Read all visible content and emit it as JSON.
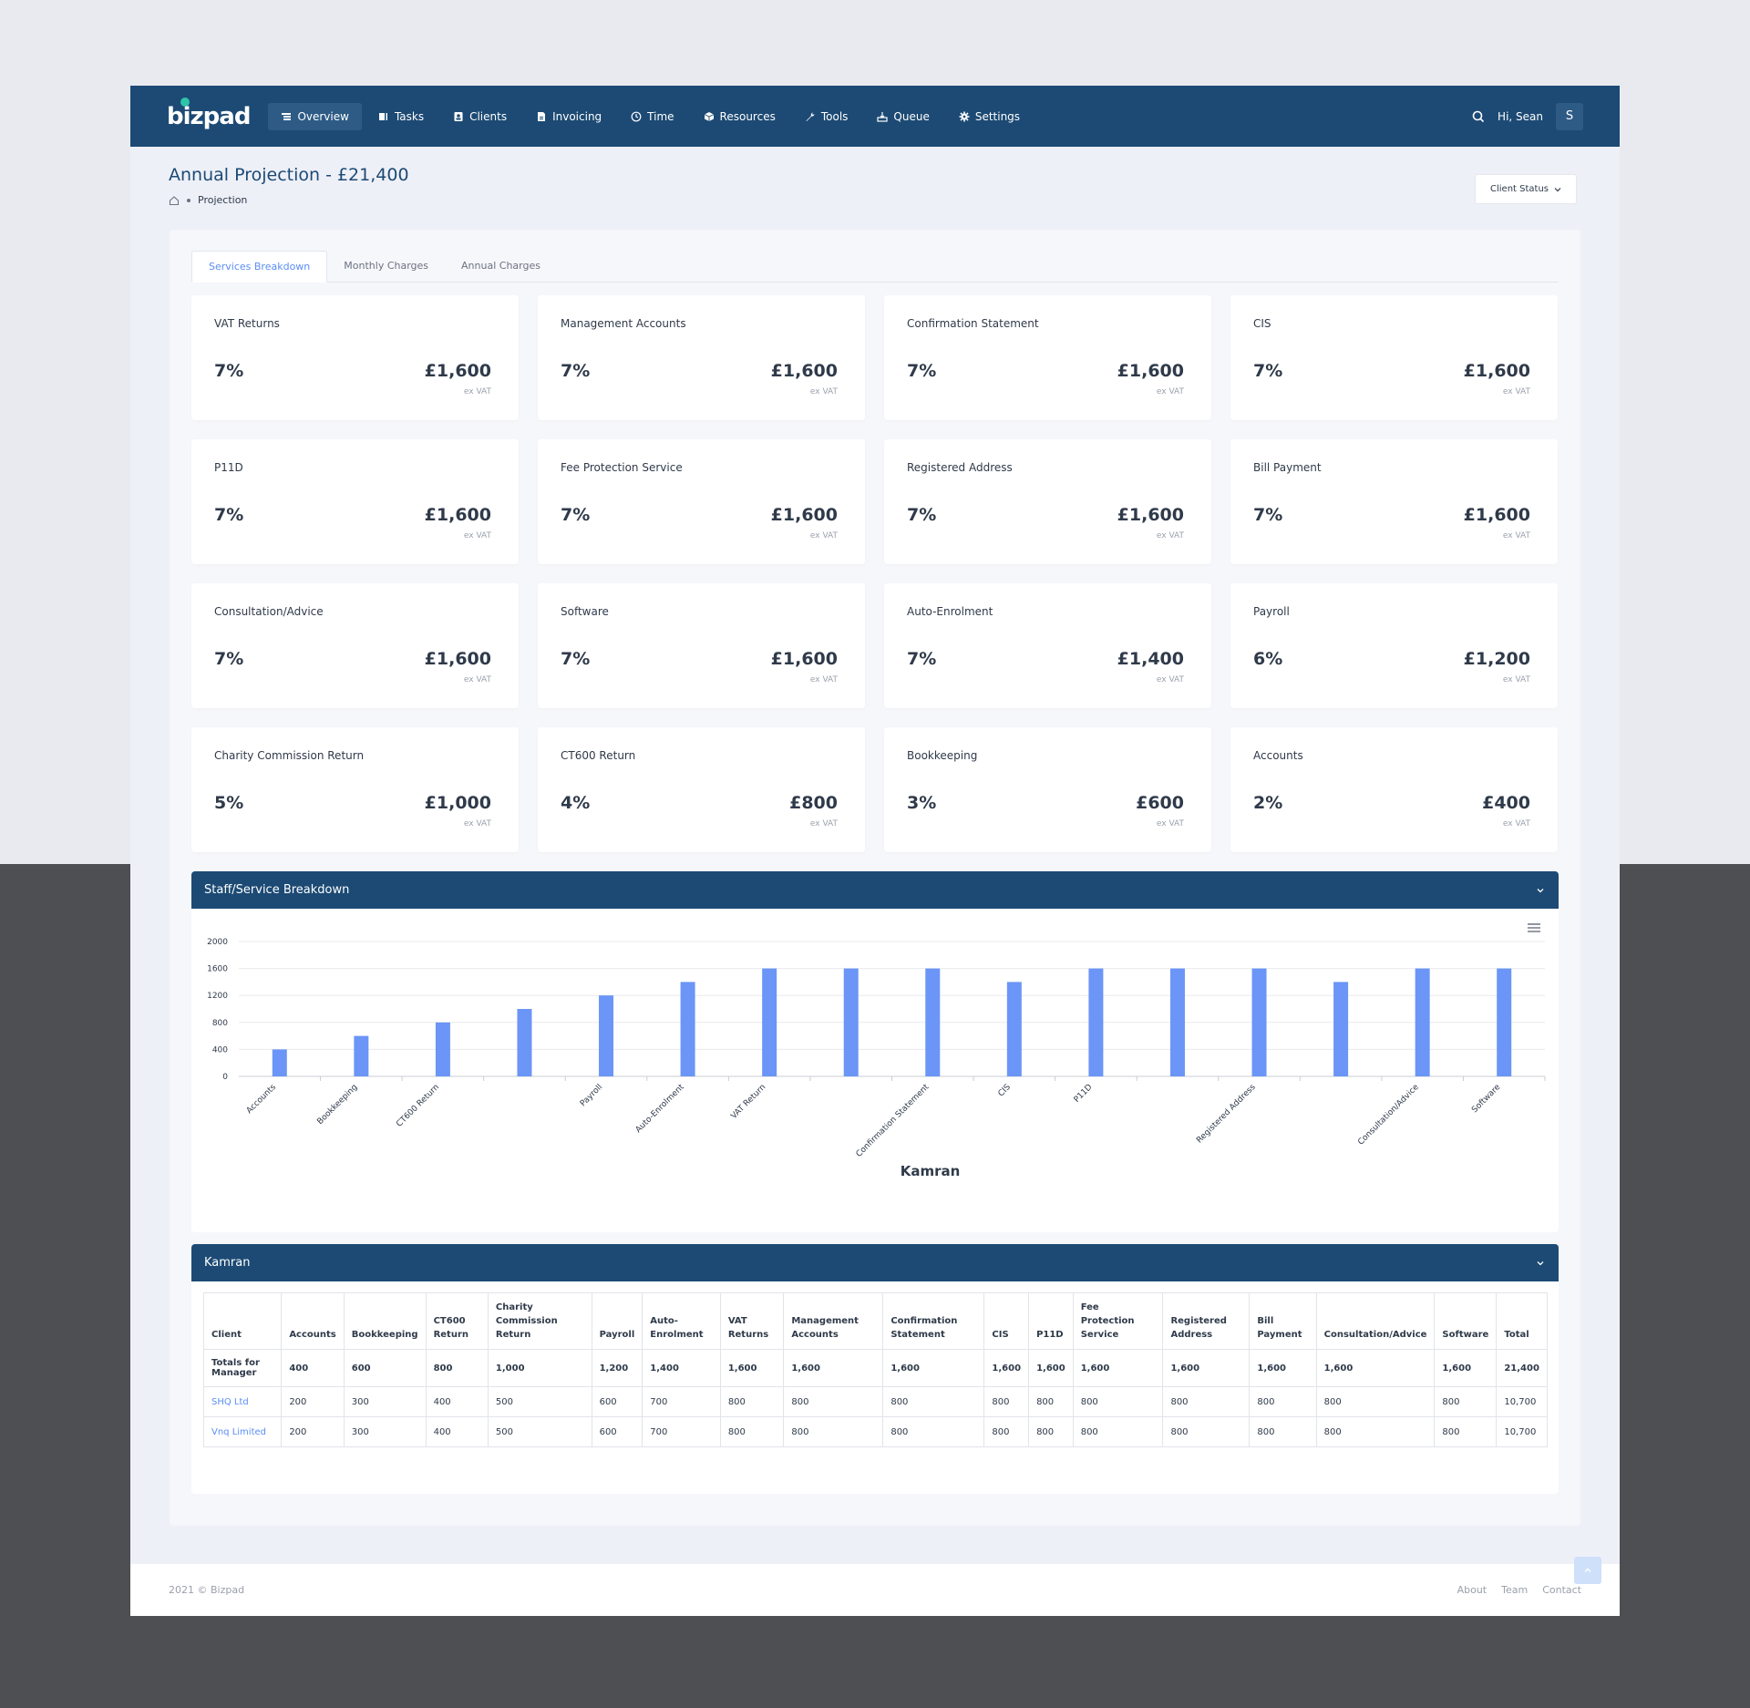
{
  "brand": {
    "logo": "bizpad"
  },
  "nav": [
    {
      "label": "Overview",
      "icon": "overview-icon",
      "active": true
    },
    {
      "label": "Tasks",
      "icon": "tasks-icon"
    },
    {
      "label": "Clients",
      "icon": "clients-icon"
    },
    {
      "label": "Invoicing",
      "icon": "invoicing-icon"
    },
    {
      "label": "Time",
      "icon": "clock-icon"
    },
    {
      "label": "Resources",
      "icon": "resources-icon"
    },
    {
      "label": "Tools",
      "icon": "wrench-icon"
    },
    {
      "label": "Queue",
      "icon": "queue-icon"
    },
    {
      "label": "Settings",
      "icon": "gear-icon"
    }
  ],
  "user": {
    "greeting": "Hi, Sean",
    "initial": "S"
  },
  "page": {
    "title": "Annual Projection - £21,400",
    "breadcrumb": "Projection",
    "client_status": "Client Status"
  },
  "tabs": [
    {
      "label": "Services Breakdown",
      "active": true
    },
    {
      "label": "Monthly Charges"
    },
    {
      "label": "Annual Charges"
    }
  ],
  "cards": [
    {
      "name": "VAT Returns",
      "pct": "7%",
      "amount": "£1,600",
      "vat": "ex VAT"
    },
    {
      "name": "Management Accounts",
      "pct": "7%",
      "amount": "£1,600",
      "vat": "ex VAT"
    },
    {
      "name": "Confirmation Statement",
      "pct": "7%",
      "amount": "£1,600",
      "vat": "ex VAT"
    },
    {
      "name": "CIS",
      "pct": "7%",
      "amount": "£1,600",
      "vat": "ex VAT"
    },
    {
      "name": "P11D",
      "pct": "7%",
      "amount": "£1,600",
      "vat": "ex VAT"
    },
    {
      "name": "Fee Protection Service",
      "pct": "7%",
      "amount": "£1,600",
      "vat": "ex VAT"
    },
    {
      "name": "Registered Address",
      "pct": "7%",
      "amount": "£1,600",
      "vat": "ex VAT"
    },
    {
      "name": "Bill Payment",
      "pct": "7%",
      "amount": "£1,600",
      "vat": "ex VAT"
    },
    {
      "name": "Consultation/Advice",
      "pct": "7%",
      "amount": "£1,600",
      "vat": "ex VAT"
    },
    {
      "name": "Software",
      "pct": "7%",
      "amount": "£1,600",
      "vat": "ex VAT"
    },
    {
      "name": "Auto-Enrolment",
      "pct": "7%",
      "amount": "£1,400",
      "vat": "ex VAT"
    },
    {
      "name": "Payroll",
      "pct": "6%",
      "amount": "£1,200",
      "vat": "ex VAT"
    },
    {
      "name": "Charity Commission Return",
      "pct": "5%",
      "amount": "£1,000",
      "vat": "ex VAT"
    },
    {
      "name": "CT600 Return",
      "pct": "4%",
      "amount": "£800",
      "vat": "ex VAT"
    },
    {
      "name": "Bookkeeping",
      "pct": "3%",
      "amount": "£600",
      "vat": "ex VAT"
    },
    {
      "name": "Accounts",
      "pct": "2%",
      "amount": "£400",
      "vat": "ex VAT"
    }
  ],
  "chart_section": {
    "title": "Staff/Service Breakdown"
  },
  "chart_data": {
    "type": "bar",
    "xlabel": "Kamran",
    "ylim": [
      0,
      2000
    ],
    "yticks": [
      0,
      400,
      800,
      1200,
      1600,
      2000
    ],
    "grid": true,
    "legend": "none",
    "color": "#6b95f6",
    "categories": [
      "Accounts",
      "Bookkeeping",
      "CT600 Return",
      "",
      "Payroll",
      "Auto-Enrolment",
      "VAT Return",
      "",
      "Confirmation Statement",
      "CIS",
      "P11D",
      "",
      "Registered Address",
      "",
      "Consultation/Advice",
      "Software"
    ],
    "values": [
      400,
      600,
      800,
      1000,
      1200,
      1400,
      1600,
      1600,
      1600,
      1400,
      1600,
      1600,
      1600,
      1400,
      1600,
      1600
    ]
  },
  "table_section": {
    "title": "Kamran",
    "headers": [
      "Client",
      "Accounts",
      "Bookkeeping",
      "CT600 Return",
      "Charity Commission Return",
      "Payroll",
      "Auto-Enrolment",
      "VAT Returns",
      "Management Accounts",
      "Confirmation Statement",
      "CIS",
      "P11D",
      "Fee Protection Service",
      "Registered Address",
      "Bill Payment",
      "Consultation/Advice",
      "Software",
      "Total"
    ],
    "totals": [
      "Totals for Manager",
      "400",
      "600",
      "800",
      "1,000",
      "1,200",
      "1,400",
      "1,600",
      "1,600",
      "1,600",
      "1,600",
      "1,600",
      "1,600",
      "1,600",
      "1,600",
      "1,600",
      "1,600",
      "21,400"
    ],
    "rows": [
      [
        "SHQ Ltd",
        "200",
        "300",
        "400",
        "500",
        "600",
        "700",
        "800",
        "800",
        "800",
        "800",
        "800",
        "800",
        "800",
        "800",
        "800",
        "800",
        "10,700"
      ],
      [
        "Vnq Limited",
        "200",
        "300",
        "400",
        "500",
        "600",
        "700",
        "800",
        "800",
        "800",
        "800",
        "800",
        "800",
        "800",
        "800",
        "800",
        "800",
        "10,700"
      ]
    ]
  },
  "footer": {
    "copyright": "2021 © Bizpad",
    "links": [
      "About",
      "Team",
      "Contact"
    ]
  }
}
